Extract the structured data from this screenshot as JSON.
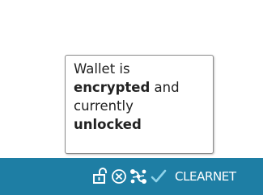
{
  "tooltip": {
    "line1": "Wallet is",
    "line2_bold": "encrypted",
    "line2_rest": " and",
    "line3": "currently",
    "line4_bold": "unlocked"
  },
  "statusbar": {
    "network_label": "CLEARNET",
    "icons": [
      "wallet-unlocked-icon",
      "proxy-disabled-icon",
      "network-connections-icon",
      "synced-check-icon"
    ],
    "background_color": "#1e7ea4"
  }
}
